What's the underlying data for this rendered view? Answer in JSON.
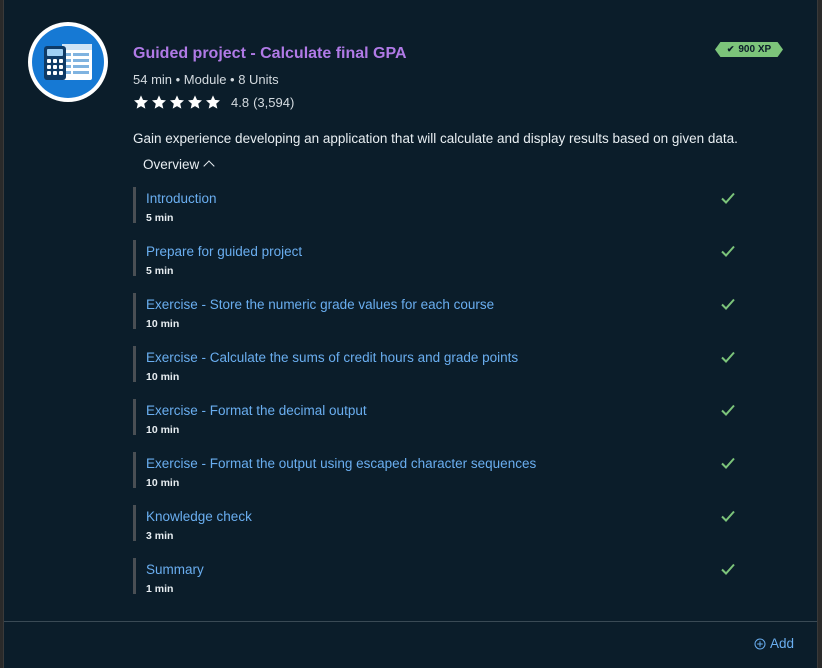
{
  "module": {
    "icon": "calculator-spreadsheet-icon",
    "title": "Guided project - Calculate final GPA",
    "meta": "54 min • Module • 8 Units",
    "rating_value": "4.8",
    "rating_count": "(3,594)",
    "stars": 5,
    "xp": "900 XP",
    "description": "Gain experience developing an application that will calculate and display results based on given data.",
    "overview_label": "Overview"
  },
  "units": [
    {
      "name": "Introduction",
      "duration": "5 min",
      "completed": true
    },
    {
      "name": "Prepare for guided project",
      "duration": "5 min",
      "completed": true
    },
    {
      "name": "Exercise - Store the numeric grade values for each course",
      "duration": "10 min",
      "completed": true
    },
    {
      "name": "Exercise - Calculate the sums of credit hours and grade points",
      "duration": "10 min",
      "completed": true
    },
    {
      "name": "Exercise - Format the decimal output",
      "duration": "10 min",
      "completed": true
    },
    {
      "name": "Exercise - Format the output using escaped character sequences",
      "duration": "10 min",
      "completed": true
    },
    {
      "name": "Knowledge check",
      "duration": "3 min",
      "completed": true
    },
    {
      "name": "Summary",
      "duration": "1 min",
      "completed": true
    }
  ],
  "footer": {
    "add_label": "Add"
  },
  "colors": {
    "background": "#0b1d2a",
    "title": "#b07ae6",
    "link": "#6aaef0",
    "check": "#7cc47a",
    "xp_badge": "#7cc47a"
  }
}
